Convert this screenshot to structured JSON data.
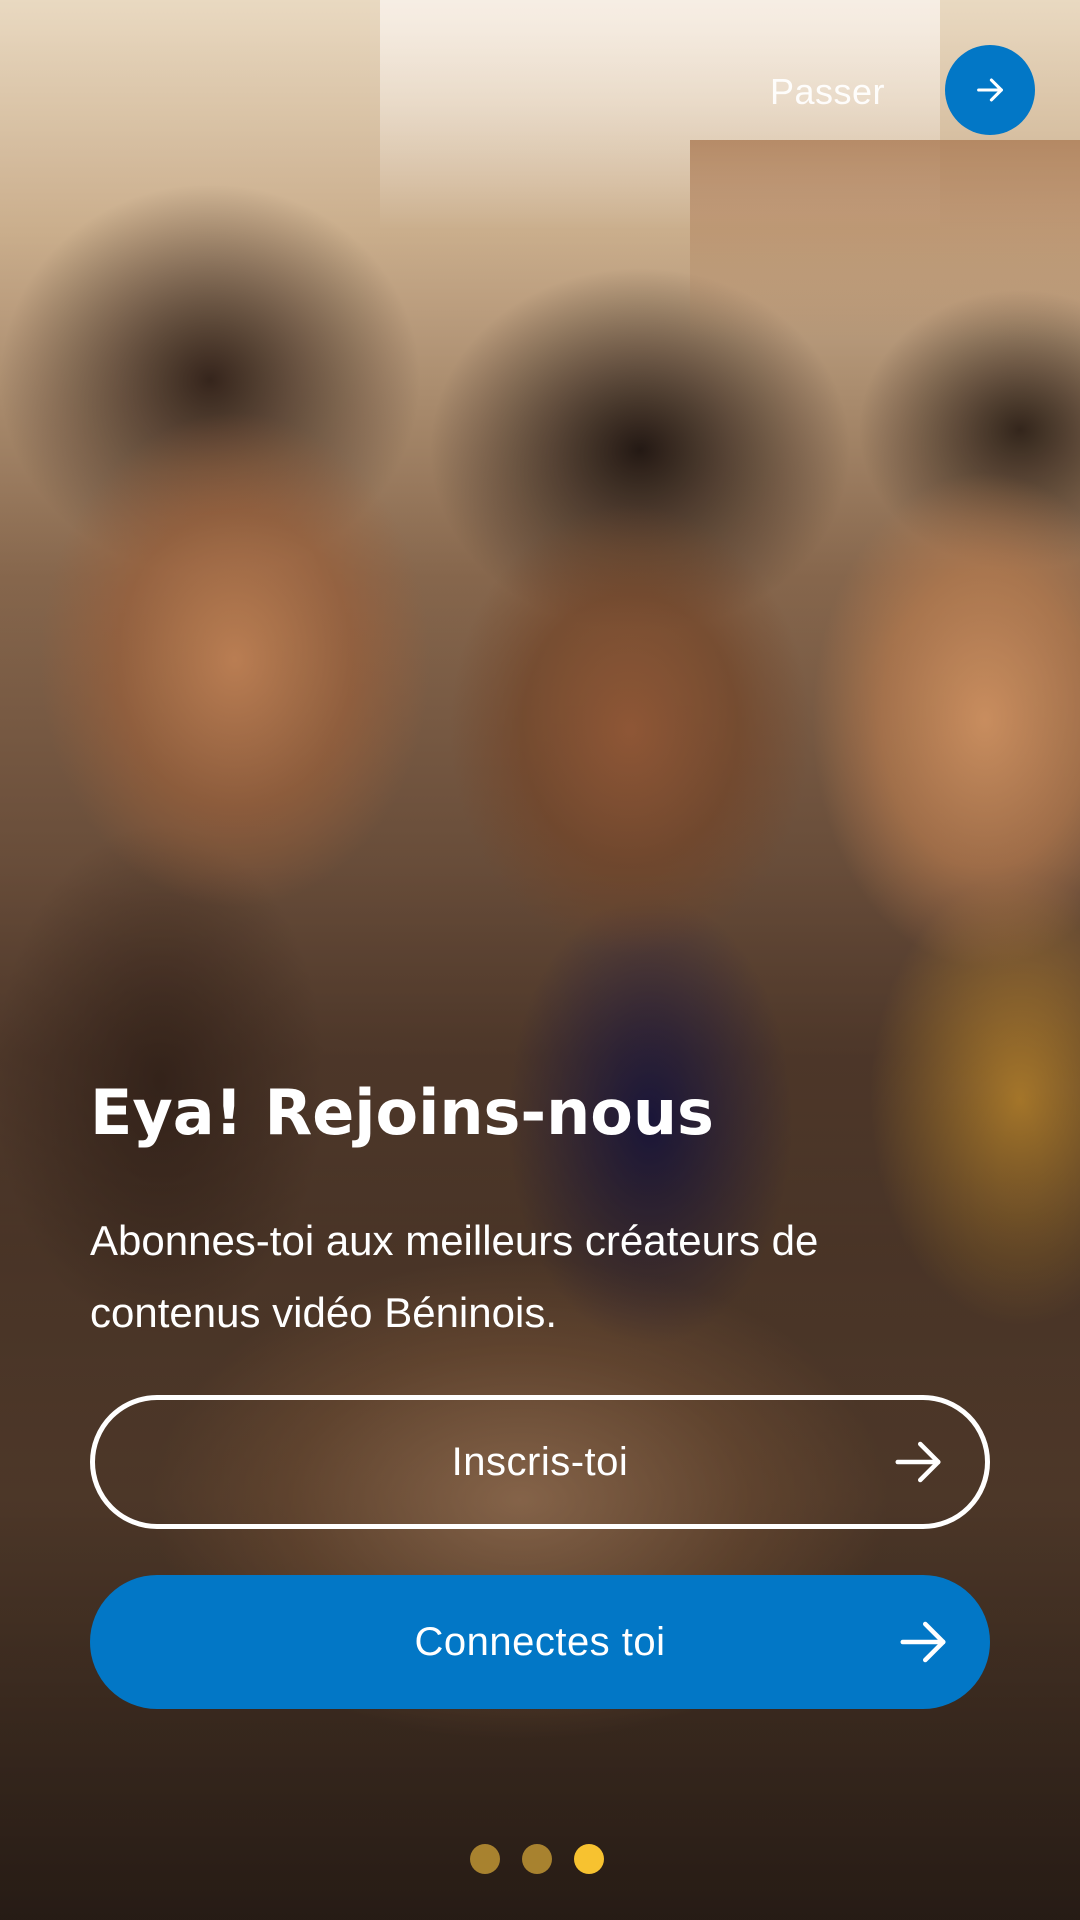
{
  "header": {
    "skip_label": "Passer"
  },
  "main": {
    "title": "Eya! Rejoins-nous",
    "subtitle": "Abonnes-toi aux meilleurs créateurs de contenus vidéo Béninois."
  },
  "actions": {
    "signup_label": "Inscris-toi",
    "login_label": "Connectes toi"
  },
  "pager": {
    "total": 3,
    "active_index": 2,
    "inactive_color": "#a8822f",
    "active_color": "#f7c230"
  },
  "colors": {
    "accent": "#0277c6"
  },
  "icons": {
    "skip": "arrow-right-icon",
    "signup": "arrow-right-icon",
    "login": "arrow-right-icon"
  }
}
